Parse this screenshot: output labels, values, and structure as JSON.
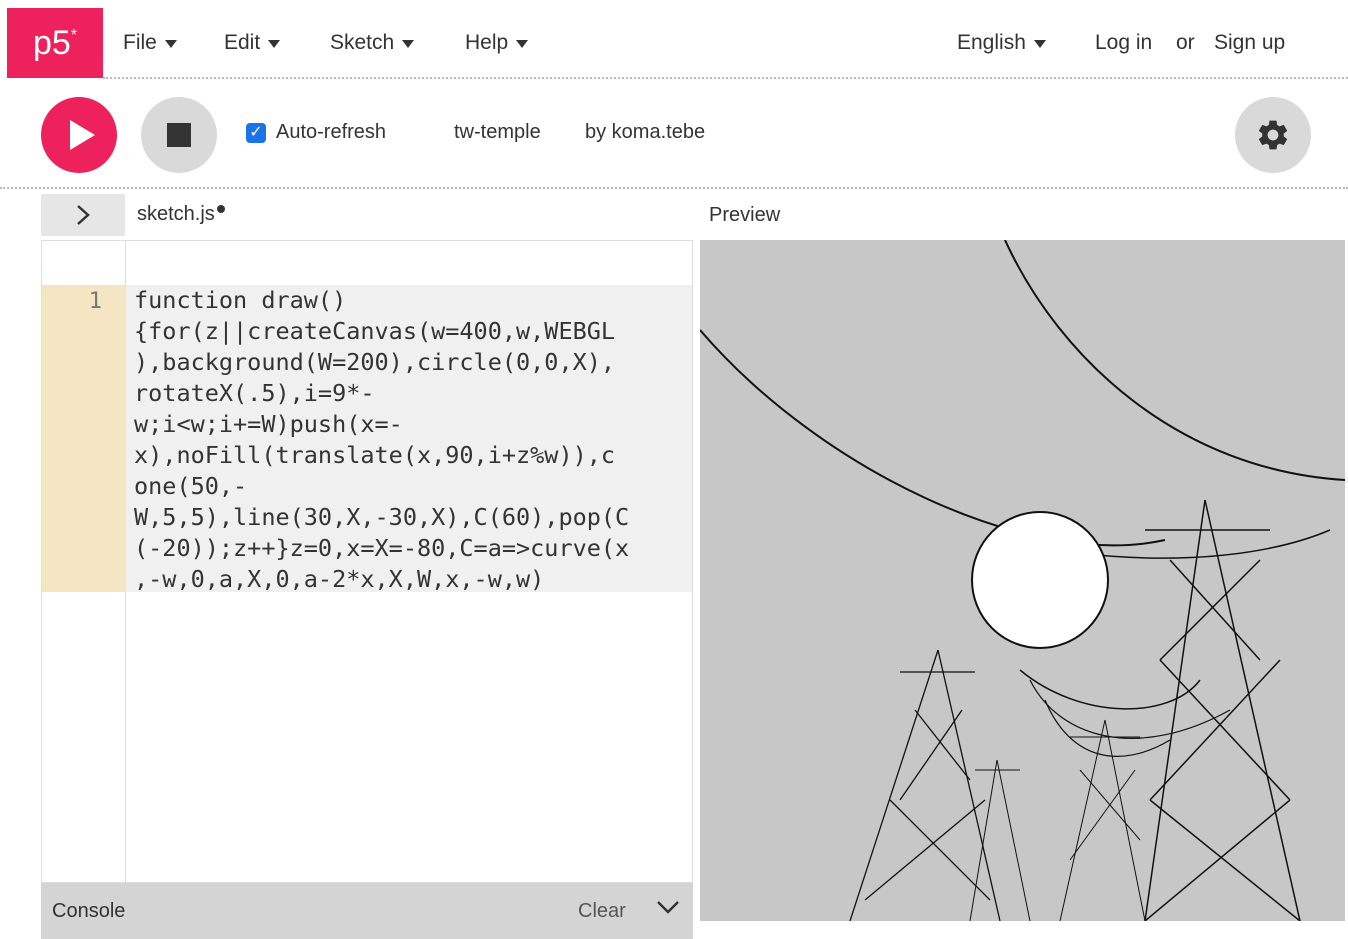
{
  "nav": {
    "logo": "p5",
    "logo_sup": "*",
    "menu": [
      "File",
      "Edit",
      "Sketch",
      "Help"
    ],
    "language": "English",
    "login": "Log in",
    "or": "or",
    "signup": "Sign up"
  },
  "toolbar": {
    "auto_refresh_label": "Auto-refresh",
    "auto_refresh_checked": true,
    "sketch_name": "tw-temple",
    "author": "by koma.tebe"
  },
  "editor": {
    "tab_name": "sketch.js",
    "line_number": "1",
    "code_lines": [
      "function draw()",
      "{for(z||createCanvas(w=400,w,WEBGL",
      "),background(W=200),circle(0,0,X),",
      "rotateX(.5),i=9*-",
      "w;i<w;i+=W)push(x=-",
      "x),noFill(translate(x,90,i+z%w)),c",
      "one(50,-",
      "W,5,5),line(30,X,-30,X),C(60),pop(C",
      "(-20));z++}z=0,x=X=-80,C=a=>curve(x",
      ",-w,0,a,X,0,a-2*x,X,W,x,-w,w)"
    ]
  },
  "preview": {
    "label": "Preview",
    "background": "#c7c7c7"
  },
  "console": {
    "label": "Console",
    "clear": "Clear"
  },
  "colors": {
    "accent": "#ed225d",
    "gutter_active": "#f4e6c2"
  }
}
